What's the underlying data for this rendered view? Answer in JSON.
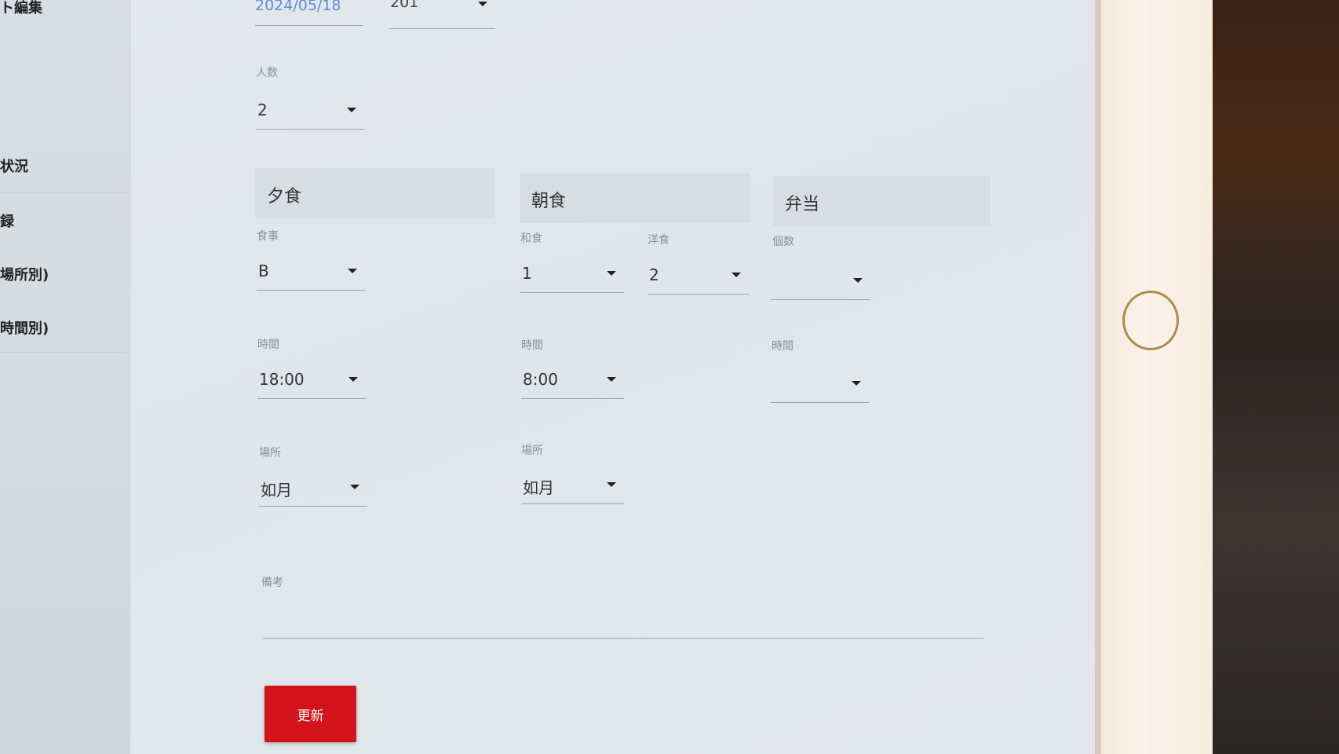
{
  "sidebar": {
    "items": [
      {
        "label": "ト編集"
      },
      {
        "label": "状況"
      },
      {
        "label": "録"
      },
      {
        "label": "場所別)"
      },
      {
        "label": "時間別)"
      }
    ]
  },
  "top": {
    "date_value": "2024/05/18",
    "room_value": "201"
  },
  "guests": {
    "label": "人数",
    "value": "2"
  },
  "dinner": {
    "header": "夕食",
    "meal_label": "食事",
    "meal_value": "B",
    "time_label": "時間",
    "time_value": "18:00",
    "place_label": "場所",
    "place_value": "如月"
  },
  "breakfast": {
    "header": "朝食",
    "japanese_label": "和食",
    "japanese_value": "1",
    "western_label": "洋食",
    "western_value": "2",
    "time_label": "時間",
    "time_value": "8:00",
    "place_label": "場所",
    "place_value": "如月"
  },
  "bento": {
    "header": "弁当",
    "count_label": "個数",
    "count_value": "",
    "time_label": "時間",
    "time_value": ""
  },
  "notes": {
    "label": "備考",
    "value": ""
  },
  "actions": {
    "update_label": "更新"
  },
  "colors": {
    "update_button": "#d4141a",
    "date_text": "#5b8fd8",
    "home_button_ring": "#b08a4a"
  }
}
